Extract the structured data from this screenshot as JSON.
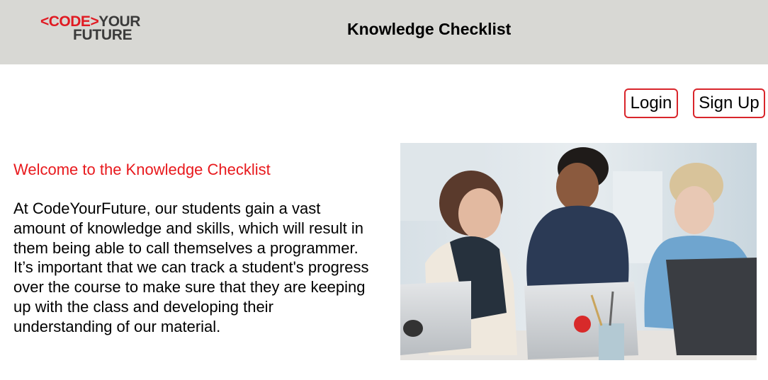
{
  "header": {
    "logo": {
      "bracket": "<",
      "code": "CODE",
      "arrow": ">",
      "your": "YOUR",
      "future": "FUTURE"
    },
    "title": "Knowledge Checklist",
    "background": "#d8d8d4"
  },
  "auth": {
    "login_label": "Login",
    "signup_label": "Sign Up",
    "border_color": "#d9252b"
  },
  "main": {
    "welcome": "Welcome to the Knowledge Checklist",
    "welcome_color": "#e8191d",
    "intro": "At CodeYourFuture, our students gain a vast amount of knowledge and skills, which will result in them being able to call themselves a programmer. It’s important that we can track a student's progress over the course to make sure that they are keeping up with the class and developing their understanding of our material."
  },
  "photo": {
    "icon": "students-at-laptops-photo"
  }
}
